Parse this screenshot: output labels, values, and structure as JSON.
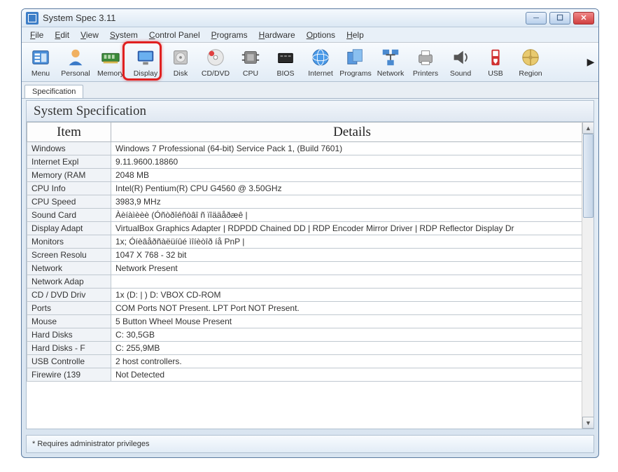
{
  "window": {
    "title": "System Spec 3.11"
  },
  "menubar": [
    "File",
    "Edit",
    "View",
    "System",
    "Control Panel",
    "Programs",
    "Hardware",
    "Options",
    "Help"
  ],
  "toolbar": [
    {
      "label": "Menu",
      "icon": "menu"
    },
    {
      "label": "Personal",
      "icon": "personal"
    },
    {
      "label": "Memory",
      "icon": "memory"
    },
    {
      "label": "Display",
      "icon": "display"
    },
    {
      "label": "Disk",
      "icon": "disk"
    },
    {
      "label": "CD/DVD",
      "icon": "cddvd"
    },
    {
      "label": "CPU",
      "icon": "cpu"
    },
    {
      "label": "BIOS",
      "icon": "bios"
    },
    {
      "label": "Internet",
      "icon": "internet"
    },
    {
      "label": "Programs",
      "icon": "programs"
    },
    {
      "label": "Network",
      "icon": "network"
    },
    {
      "label": "Printers",
      "icon": "printers"
    },
    {
      "label": "Sound",
      "icon": "sound"
    },
    {
      "label": "USB",
      "icon": "usb"
    },
    {
      "label": "Region",
      "icon": "region"
    }
  ],
  "tab": "Specification",
  "section_title": "System Specification",
  "columns": {
    "item": "Item",
    "details": "Details"
  },
  "rows": [
    {
      "item": "Windows",
      "details": "Windows 7 Professional (64-bit) Service Pack 1,  (Build 7601)"
    },
    {
      "item": "Internet Expl",
      "details": "9.11.9600.18860"
    },
    {
      "item": "Memory (RAM",
      "details": "2048 MB"
    },
    {
      "item": "CPU Info",
      "details": "Intel(R) Pentium(R) CPU G4560 @ 3.50GHz"
    },
    {
      "item": "CPU Speed",
      "details": "3983,9 MHz"
    },
    {
      "item": "Sound Card",
      "details": "Àèíàìèèè (Óñòðîéñòâî ñ ïîääåðæê |"
    },
    {
      "item": "Display Adapt",
      "details": "VirtualBox Graphics Adapter | RDPDD Chained DD | RDP Encoder Mirror Driver | RDP Reflector Display Dr"
    },
    {
      "item": "Monitors",
      "details": "1x; Óíèâåðñàëüíûé ìîíèòîð íå PnP |"
    },
    {
      "item": "Screen Resolu",
      "details": "1047 X 768 - 32 bit"
    },
    {
      "item": "Network",
      "details": "Network Present"
    },
    {
      "item": "Network Adap",
      "details": ""
    },
    {
      "item": "CD / DVD Driv",
      "details": "1x (D: | ) D: VBOX   CD-ROM"
    },
    {
      "item": "Ports",
      "details": "COM Ports NOT Present. LPT Port NOT Present."
    },
    {
      "item": "Mouse",
      "details": "5 Button Wheel Mouse Present"
    },
    {
      "item": "Hard Disks",
      "details": "C:  30,5GB"
    },
    {
      "item": "Hard Disks - F",
      "details": "C:  255,9MB"
    },
    {
      "item": "USB Controlle",
      "details": "2 host controllers."
    },
    {
      "item": "Firewire (139",
      "details": "Not Detected"
    }
  ],
  "statusbar": "*  Requires administrator privileges"
}
